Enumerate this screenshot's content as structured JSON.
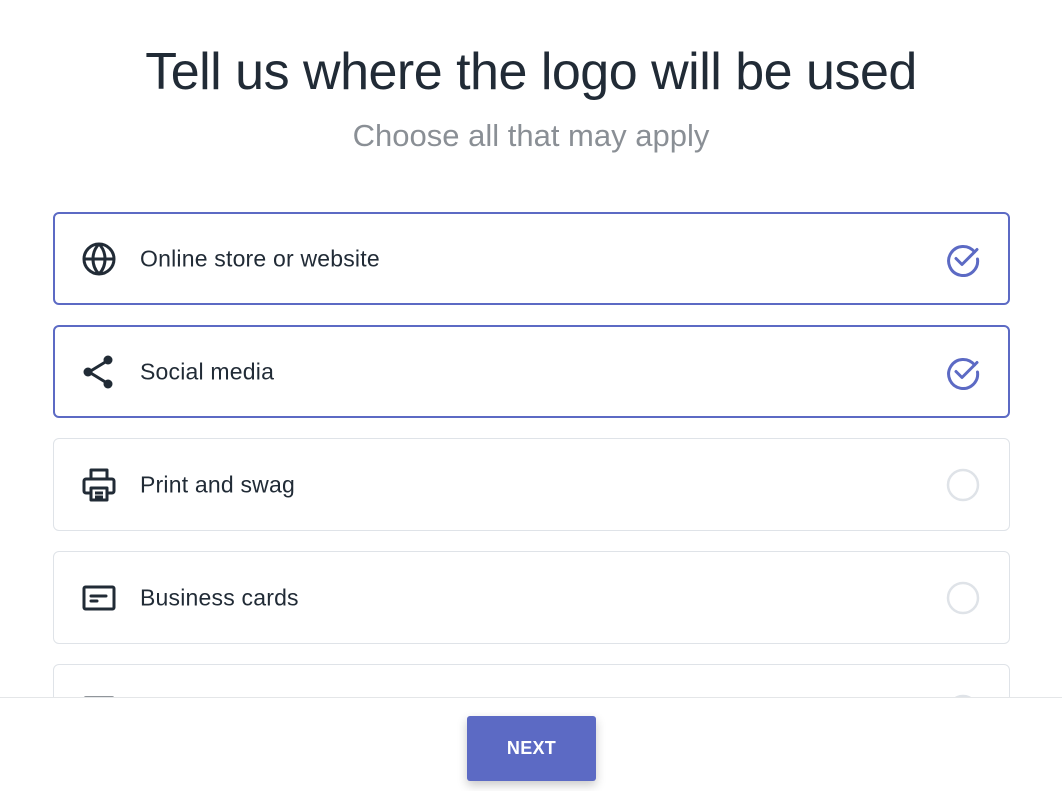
{
  "header": {
    "title": "Tell us where the logo will be used",
    "subtitle": "Choose all that may apply"
  },
  "colors": {
    "accent": "#5c6ac4",
    "text": "#212b36",
    "muted": "#8a8f95",
    "border": "#dfe3e8"
  },
  "options": [
    {
      "label": "Online store or website",
      "icon": "globe-icon",
      "selected": true
    },
    {
      "label": "Social media",
      "icon": "share-icon",
      "selected": true
    },
    {
      "label": "Print and swag",
      "icon": "printer-icon",
      "selected": false
    },
    {
      "label": "Business cards",
      "icon": "business-card-icon",
      "selected": false
    },
    {
      "label": "",
      "icon": "partially-hidden-icon",
      "selected": false
    }
  ],
  "footer": {
    "next_label": "NEXT"
  }
}
